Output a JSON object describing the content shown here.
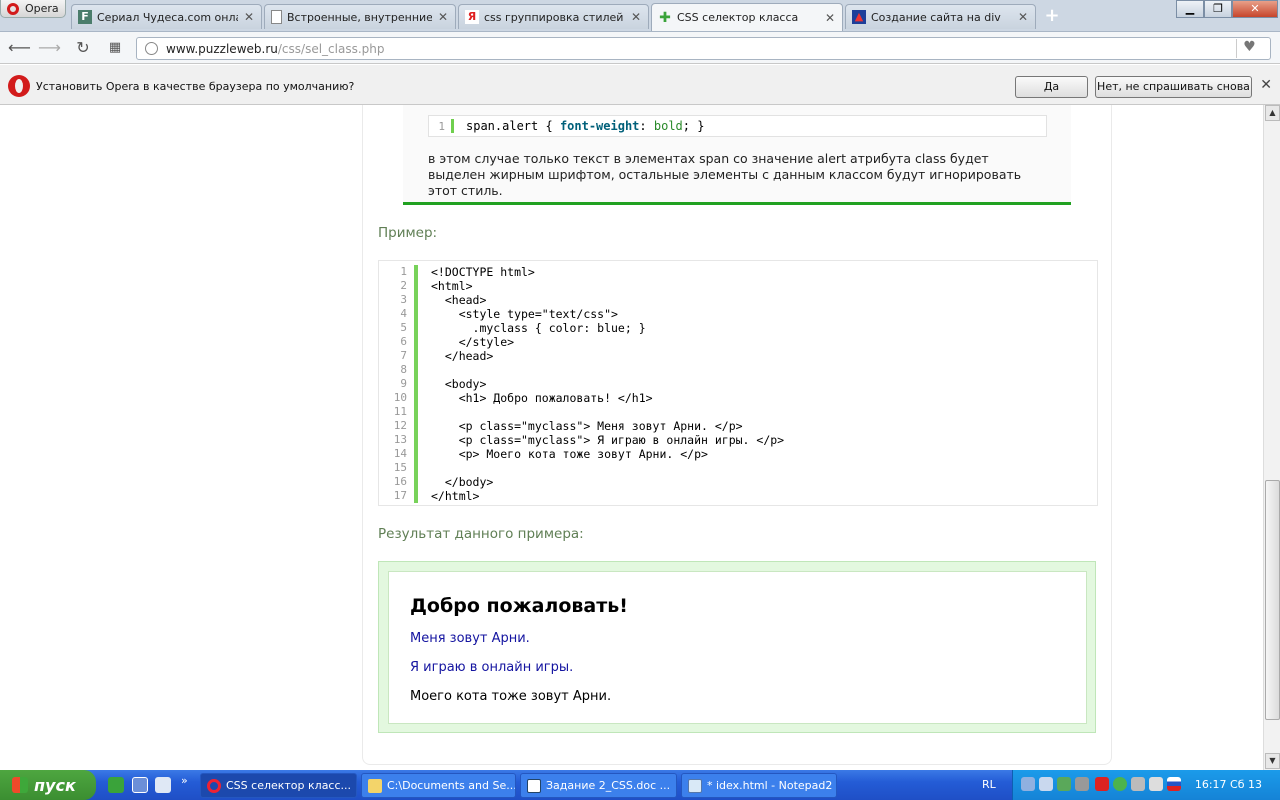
{
  "browser": {
    "menu_label": "Opera",
    "tabs": [
      {
        "title": "Сериал Чудеса.com онлайн",
        "icon": "F"
      },
      {
        "title": "Встроенные, внутренние и",
        "icon": ""
      },
      {
        "title": "css группировка стилей — Я",
        "icon": "Я"
      },
      {
        "title": "CSS селектор класса",
        "icon": ""
      },
      {
        "title": "Создание сайта на div",
        "icon": ""
      }
    ],
    "url_domain": "www.puzzleweb.ru",
    "url_path": "/css/sel_class.php",
    "infobar_text": "Установить Opera в качестве браузера по умолчанию?",
    "infobar_yes": "Да",
    "infobar_no": "Нет, не спрашивать снова"
  },
  "page": {
    "snippet_num": "1",
    "snippet_sel": "span.alert",
    "snippet_prop": "font-weight",
    "snippet_val": "bold",
    "desc": "в этом случае только текст в элементах span со значение alert атрибута class будет выделен жирным шрифтом, остальные элементы с данным классом будут игнорировать этот стиль.",
    "example_heading": "Пример:",
    "code_lines": [
      "<!DOCTYPE html>",
      "<html>",
      "  <head>",
      "    <style type=\"text/css\">",
      "      .myclass { color: blue; }",
      "    </style>",
      "  </head>",
      "",
      "  <body>",
      "    <h1> Добро пожаловать! </h1>",
      "",
      "    <p class=\"myclass\"> Меня зовут Арни. </p>",
      "    <p class=\"myclass\"> Я играю в онлайн игры. </p>",
      "    <p> Моего кота тоже зовут Арни. </p>",
      "",
      "  </body>",
      "</html>"
    ],
    "result_heading": "Результат данного примера:",
    "result_h1": "Добро пожаловать!",
    "result_p1": "Меня зовут Арни.",
    "result_p2": "Я играю в онлайн игры.",
    "result_p3": "Моего кота тоже зовут Арни."
  },
  "taskbar": {
    "start_label": "пуск",
    "buttons": [
      "CSS селектор класс...",
      "C:\\Documents and Se...",
      "Задание 2_CSS.doc ...",
      "* idex.html - Notepad2"
    ],
    "lang": "RL",
    "clock": "16:17 Сб 13"
  },
  "colors": {
    "accent_green": "#21a121",
    "link_blue": "#1414a0"
  }
}
